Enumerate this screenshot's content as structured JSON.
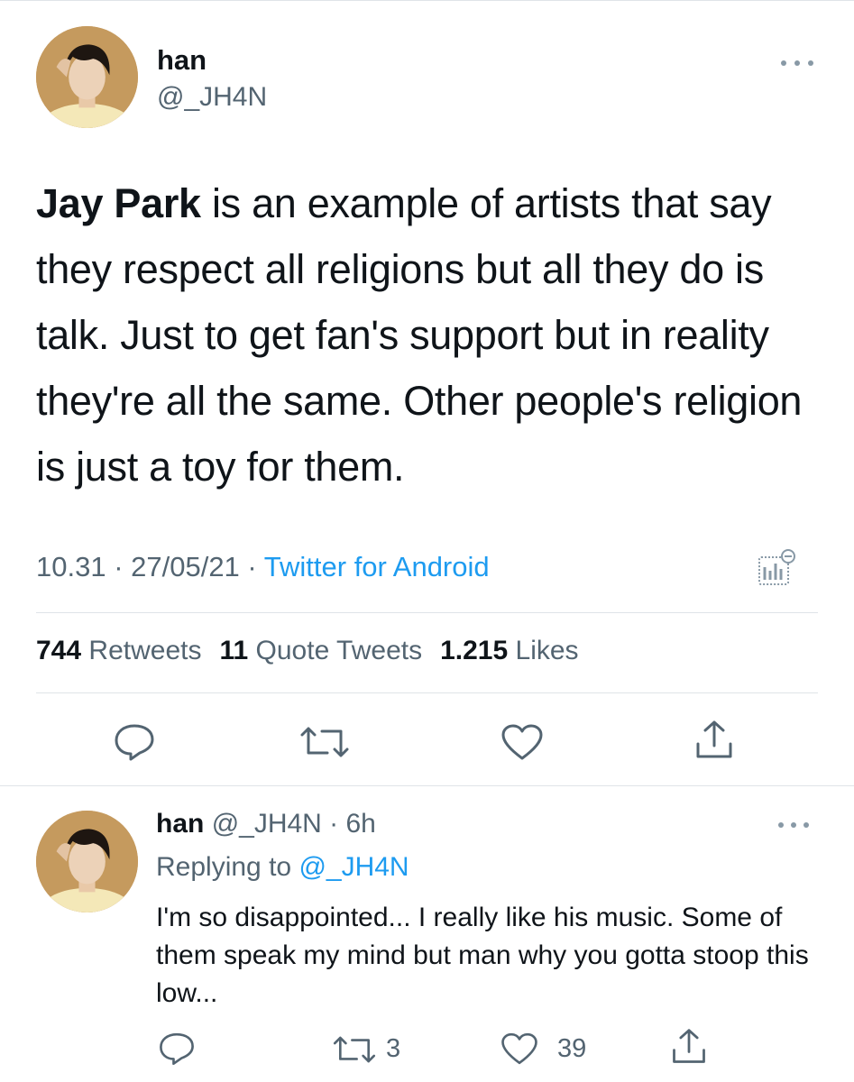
{
  "tweet": {
    "author_name": "han",
    "author_handle": "@_JH4N",
    "text_bold": "Jay Park",
    "text_rest": " is an example of artists that say they respect all religions but all they do is talk. Just to get fan's support but in reality they're all the same. Other people's religion is just a toy for them.",
    "time_date": "10.31 · 27/05/21 · ",
    "source": "Twitter for Android",
    "retweets_count": "744",
    "retweets_label": "Retweets",
    "quotes_count": "11",
    "quotes_label": "Quote Tweets",
    "likes_count": "1.215",
    "likes_label": "Likes"
  },
  "reply": {
    "author_name": "han",
    "meta": "@_JH4N · 6h",
    "replying_prefix": "Replying to ",
    "replying_to": "@_JH4N",
    "text": "I'm so disappointed... I really like his music. Some of them speak my mind but man why you gotta stoop this low...",
    "retweet_count": "3",
    "like_count": "39"
  },
  "icons": {
    "more": "more-horizontal-icon",
    "analytics": "analytics-icon",
    "reply": "reply-icon",
    "retweet": "retweet-icon",
    "like": "heart-icon",
    "share": "share-icon"
  },
  "colors": {
    "link": "#1d9bf0",
    "secondary_text": "#536471",
    "primary_text": "#0f1419",
    "divider": "#dfe4e8"
  }
}
